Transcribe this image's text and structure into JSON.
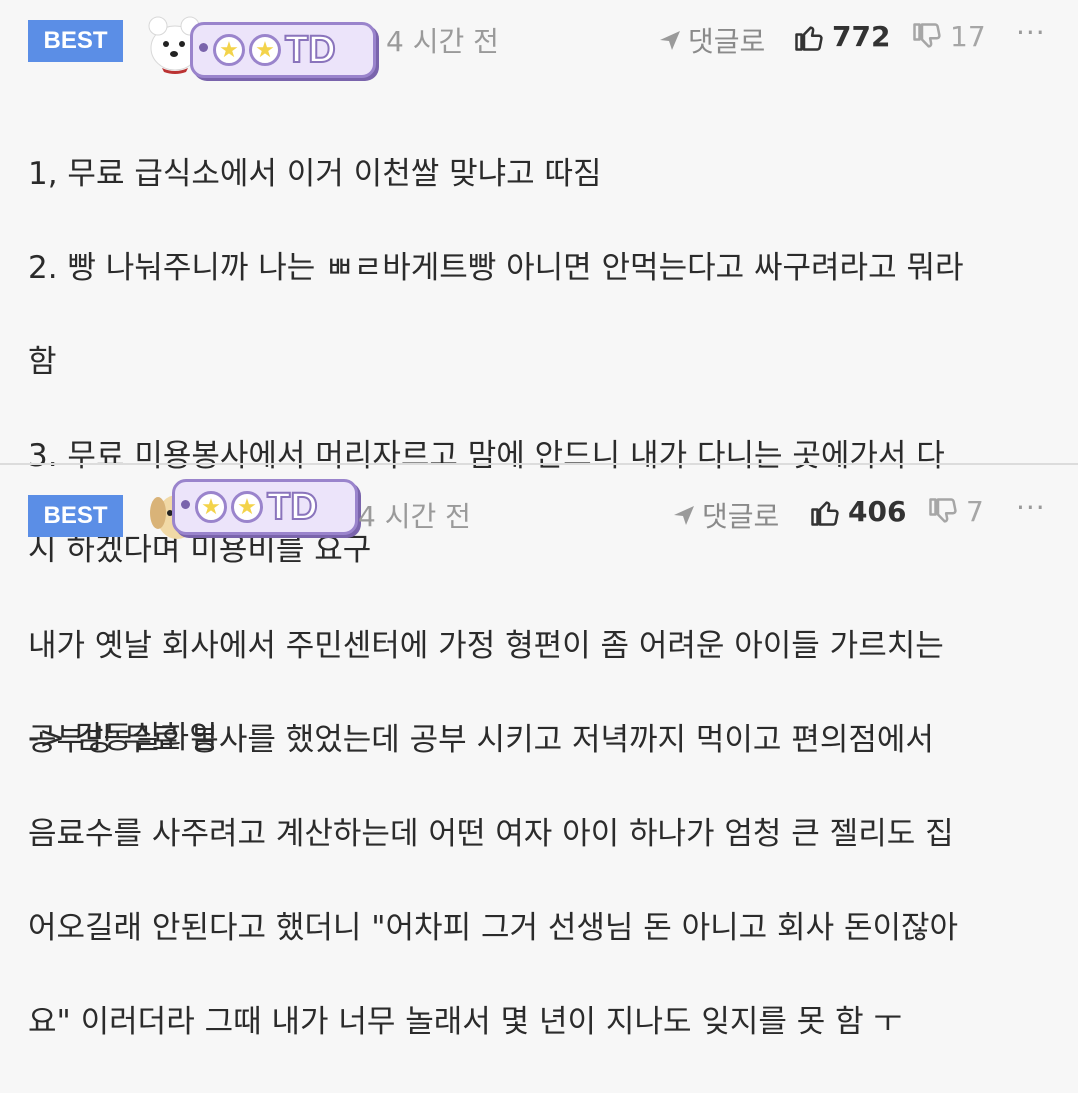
{
  "comments": [
    {
      "badge": "BEST",
      "avatar": "white-dog-avatar",
      "nick_badge": "OOTD",
      "time": "4 시간 전",
      "reply_label": "댓글로",
      "likes": "772",
      "dislikes": "17",
      "more": "···",
      "lines": [
        "1, 무료 급식소에서 이거 이천쌀 맞냐고 따짐",
        "2. 빵 나눠주니까 나는 ㅃㄹ바게트빵 아니면 안먹는다고 싸구려라고 뭐라",
        "함",
        "3. 무료 미용봉사에서 머리자르고 맘에 안드니 내가 다니는 곳에가서 다",
        "시 하겠다며 미용비를 요구",
        "",
        "-> 감동실화임"
      ]
    },
    {
      "badge": "BEST",
      "avatar": "puppy-avatar",
      "nick_badge": "OOTD",
      "time": "4 시간 전",
      "reply_label": "댓글로",
      "likes": "406",
      "dislikes": "7",
      "more": "···",
      "lines": [
        "내가 옛날 회사에서 주민센터에 가정 형편이 좀 어려운 아이들 가르치는",
        "공부방 무료 봉사를 했었는데 공부 시키고 저녁까지 먹이고 편의점에서",
        "음료수를 사주려고 계산하는데 어떤 여자 아이 하나가 엄청 큰 젤리도 집",
        "어오길래 안된다고 했더니 \"어차피 그거 선생님 돈 아니고 회사 돈이잖아",
        "요\" 이러더라 그때 내가 너무 놀래서 몇 년이 지나도 잊지를 못 함 ㅜ"
      ]
    }
  ],
  "colors": {
    "best": "#5b8ee6",
    "badge_border": "#9a84cc",
    "badge_fill": "#ece4fa",
    "background": "#f7f7f7"
  }
}
